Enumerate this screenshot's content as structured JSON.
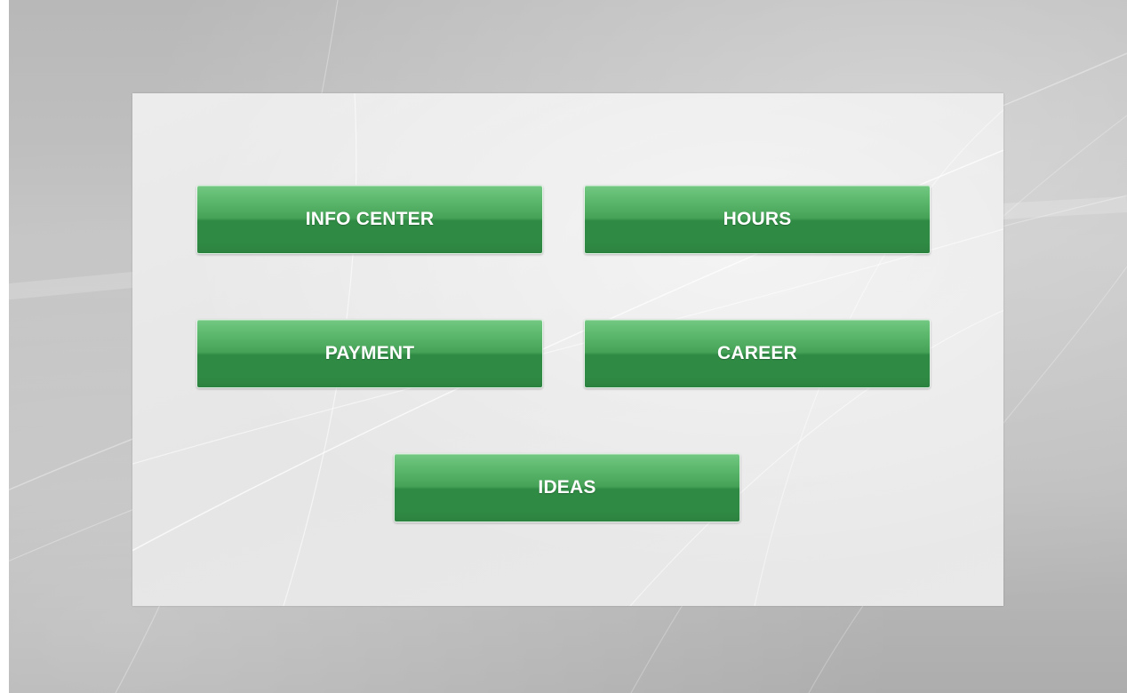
{
  "menu": {
    "buttons": [
      {
        "id": "info-center",
        "label": "INFO CENTER"
      },
      {
        "id": "hours",
        "label": "HOURS"
      },
      {
        "id": "payment",
        "label": "PAYMENT"
      },
      {
        "id": "career",
        "label": "CAREER"
      },
      {
        "id": "ideas",
        "label": "IDEAS"
      }
    ]
  },
  "colors": {
    "button_green_top": "#73c982",
    "button_green_bottom": "#2c8240",
    "button_text": "#ffffff",
    "panel_background": "#e9e9e9",
    "screen_background": "#bdbdbd"
  }
}
